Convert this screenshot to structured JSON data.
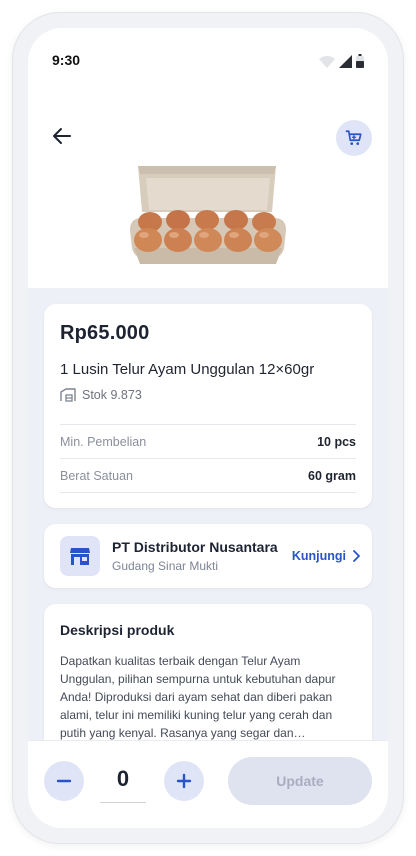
{
  "status_bar": {
    "time": "9:30"
  },
  "colors": {
    "accent": "#2953c8",
    "accent_soft": "#dfe4f7",
    "disabled": "#dfe3ef"
  },
  "product": {
    "price": "Rp65.000",
    "name": "1 Lusin Telur Ayam Unggulan 12×60gr",
    "stock": "Stok 9.873",
    "specs": [
      {
        "label": "Min. Pembelian",
        "value": "10 pcs"
      },
      {
        "label": "Berat Satuan",
        "value": "60 gram"
      }
    ]
  },
  "store": {
    "name": "PT Distributor Nusantara",
    "location": "Gudang Sinar Mukti",
    "visit_label": "Kunjungi"
  },
  "description": {
    "title": "Deskripsi produk",
    "body": "Dapatkan kualitas terbaik dengan Telur Ayam Unggulan, pilihan sempurna untuk kebutuhan dapur Anda! Diproduksi dari ayam sehat dan diberi pakan alami, telur ini memiliki kuning telur yang cerah dan putih yang kenyal. Rasanya yang segar dan kandungan gizinya yang tinggi"
  },
  "cart": {
    "quantity": "0",
    "update_label": "Update"
  },
  "icons": {
    "back": "arrow-left-icon",
    "cart": "shopping-cart-icon",
    "stock": "warehouse-icon",
    "store": "store-icon",
    "visit": "chevron-right-icon",
    "minus": "minus-icon",
    "plus": "plus-icon"
  }
}
